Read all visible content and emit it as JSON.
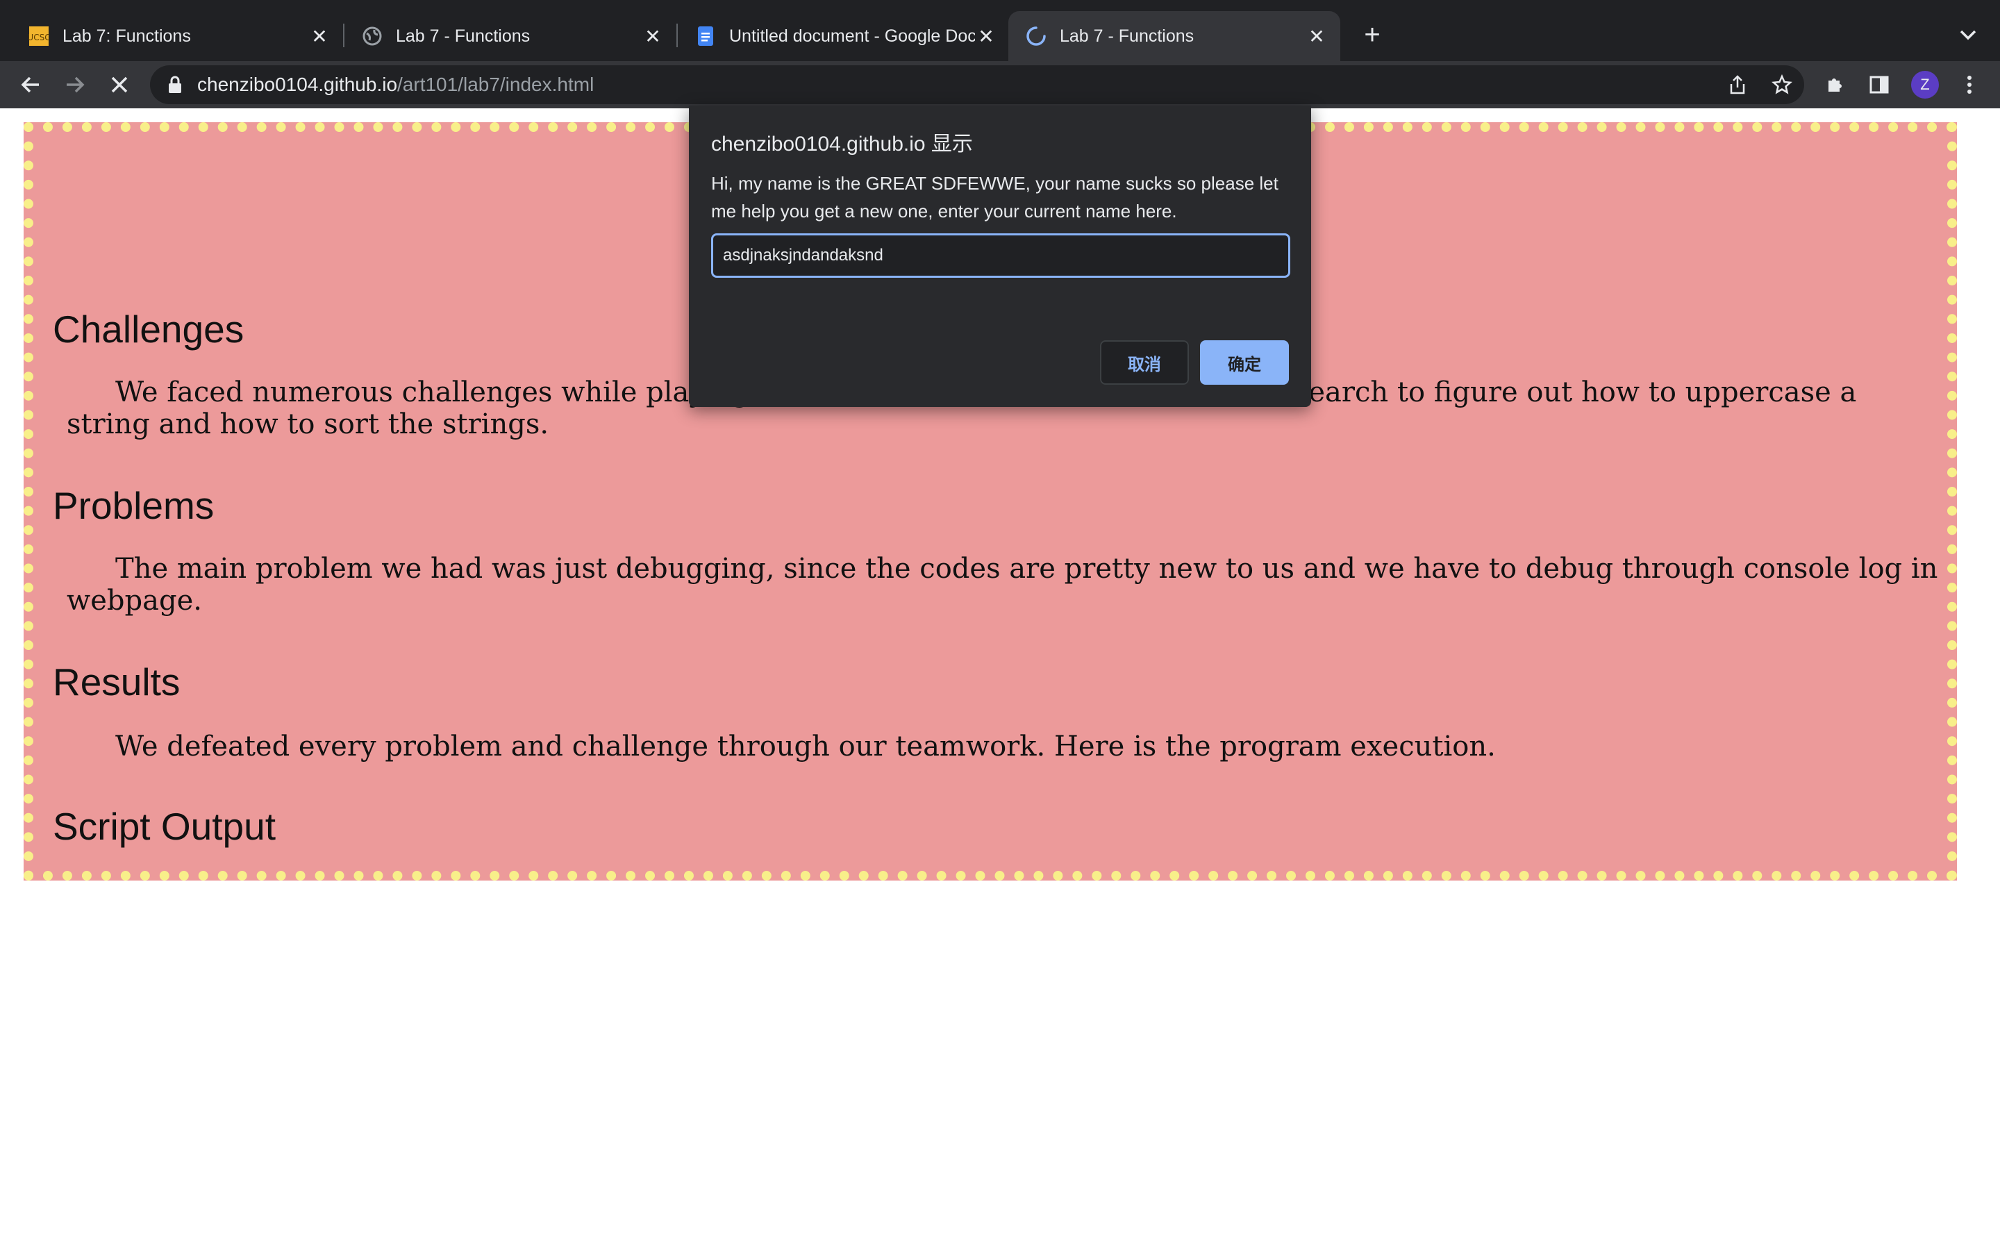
{
  "browser": {
    "tabs": [
      {
        "title": "Lab 7: Functions",
        "favicon": "ucsc-logo-icon",
        "active": false
      },
      {
        "title": "Lab 7 - Functions",
        "favicon": "globe-icon",
        "active": false
      },
      {
        "title": "Untitled document - Google Docs",
        "favicon": "google-docs-icon",
        "active": false
      },
      {
        "title": "Lab 7 - Functions",
        "favicon": "loading-spinner-icon",
        "active": true
      }
    ],
    "url_host": "chenzibo0104.github.io",
    "url_path": "/art101/lab7/index.html",
    "profile_initial": "Z",
    "colors": {
      "frame": "#202124",
      "toolbar": "#35363a",
      "accent": "#8ab4f8",
      "avatar": "#5b3dc4"
    }
  },
  "page": {
    "colors": {
      "background": "#ec9a9a",
      "dots": "#f8ef8a"
    },
    "sections": [
      {
        "heading": "Challenges",
        "text": "We faced numerous challenges while playing with the code. We had to do tons of research to figure out how to uppercase a string and how to sort the strings."
      },
      {
        "heading": "Problems",
        "text": "The main problem we had was just debugging, since the codes are pretty new to us and we have to debug through console log in webpage."
      },
      {
        "heading": "Results",
        "text": "We defeated every problem and challenge through our teamwork. Here is the program execution."
      },
      {
        "heading": "Script Output",
        "text": ""
      }
    ]
  },
  "dialog": {
    "title": "chenzibo0104.github.io 显示",
    "message": "Hi, my name is the GREAT SDFEWWE, your name sucks so please let me help you get a new one, enter your current name here.",
    "input_value": "asdjnaksjndandaksnd",
    "cancel_label": "取消",
    "ok_label": "确定"
  }
}
